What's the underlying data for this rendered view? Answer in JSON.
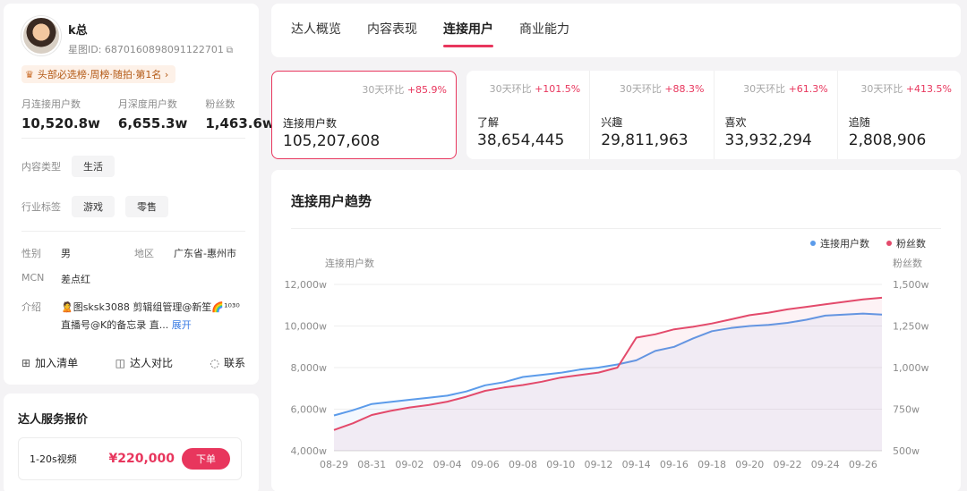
{
  "profile": {
    "name": "k总",
    "id_text": "星图ID: 6870160898091122701",
    "rank_badge": "头部必选榜·周榜·随拍·第1名 ›",
    "stats": [
      {
        "label": "月连接用户数",
        "value": "10,520.8w"
      },
      {
        "label": "月深度用户数",
        "value": "6,655.3w"
      },
      {
        "label": "粉丝数",
        "value": "1,463.6w"
      }
    ],
    "content_type_label": "内容类型",
    "content_type": "生活",
    "industry_label": "行业标签",
    "industry_tags": [
      "游戏",
      "零售"
    ],
    "gender_label": "性别",
    "gender": "男",
    "region_label": "地区",
    "region": "广东省-惠州市",
    "mcn_label": "MCN",
    "mcn": "差点红",
    "intro_label": "介绍",
    "intro": "🙎图sksk3088 剪辑组管理@新笙🌈¹⁰³⁰ 直播号@K的备忘录 直...",
    "intro_expand": "展开",
    "actions": [
      "加入清单",
      "达人对比",
      "联系"
    ]
  },
  "service": {
    "title": "达人服务报价",
    "item": "1-20s视频",
    "price": "¥220,000",
    "order_label": "下单"
  },
  "tabs": [
    "达人概览",
    "内容表现",
    "连接用户",
    "商业能力"
  ],
  "active_tab": 2,
  "metrics": [
    {
      "mom_label": "30天环比",
      "mom_value": "+85.9%",
      "label": "连接用户数",
      "value": "105,207,608"
    },
    {
      "mom_label": "30天环比",
      "mom_value": "+101.5%",
      "label": "了解",
      "value": "38,654,445"
    },
    {
      "mom_label": "30天环比",
      "mom_value": "+88.3%",
      "label": "兴趣",
      "value": "29,811,963"
    },
    {
      "mom_label": "30天环比",
      "mom_value": "+61.3%",
      "label": "喜欢",
      "value": "33,932,294"
    },
    {
      "mom_label": "30天环比",
      "mom_value": "+413.5%",
      "label": "追随",
      "value": "2,808,906"
    }
  ],
  "chart_title": "连接用户趋势",
  "chart_data": {
    "type": "line",
    "ylabel_left": "连接用户数",
    "ylabel_right": "粉丝数",
    "yticks_left": [
      "4,000w",
      "6,000w",
      "8,000w",
      "10,000w",
      "12,000w"
    ],
    "yticks_right": [
      "500w",
      "750w",
      "1,000w",
      "1,250w",
      "1,500w"
    ],
    "ylim_left": [
      4000,
      12000
    ],
    "ylim_right": [
      500,
      1500
    ],
    "legend_position": "top-right",
    "grid": true,
    "x_tick_labels": [
      "08-29",
      "08-31",
      "09-02",
      "09-04",
      "09-06",
      "09-08",
      "09-10",
      "09-12",
      "09-14",
      "09-16",
      "09-18",
      "09-20",
      "09-22",
      "09-24",
      "09-26"
    ],
    "x": [
      "08-29",
      "08-30",
      "08-31",
      "09-01",
      "09-02",
      "09-03",
      "09-04",
      "09-05",
      "09-06",
      "09-07",
      "09-08",
      "09-09",
      "09-10",
      "09-11",
      "09-12",
      "09-13",
      "09-14",
      "09-15",
      "09-16",
      "09-17",
      "09-18",
      "09-19",
      "09-20",
      "09-21",
      "09-22",
      "09-23",
      "09-24",
      "09-25",
      "09-26",
      "09-27"
    ],
    "series": [
      {
        "name": "连接用户数",
        "axis": "left",
        "color": "#5b9bea",
        "values": [
          5700,
          5950,
          6250,
          6350,
          6450,
          6550,
          6650,
          6850,
          7150,
          7300,
          7550,
          7650,
          7750,
          7900,
          8000,
          8150,
          8350,
          8800,
          9000,
          9400,
          9750,
          9900,
          10000,
          10050,
          10150,
          10300,
          10500,
          10550,
          10600,
          10550
        ]
      },
      {
        "name": "粉丝数",
        "axis": "right",
        "color": "#e34a6b",
        "values": [
          625,
          665,
          715,
          740,
          760,
          775,
          795,
          825,
          860,
          880,
          895,
          915,
          940,
          955,
          970,
          1000,
          1180,
          1200,
          1230,
          1245,
          1265,
          1290,
          1315,
          1330,
          1350,
          1365,
          1380,
          1395,
          1410,
          1420
        ]
      }
    ]
  },
  "colors": {
    "accent": "#e8365d",
    "link": "#3a7ce4",
    "blue_series": "#5b9bea",
    "red_series": "#e34a6b"
  }
}
